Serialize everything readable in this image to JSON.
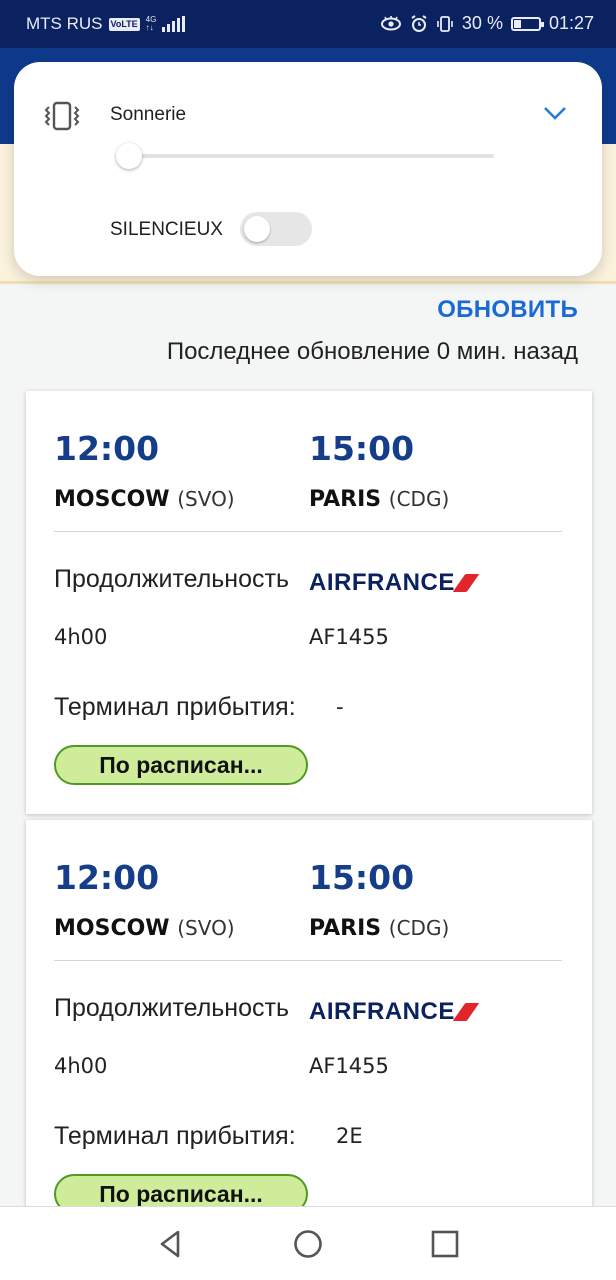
{
  "status_bar": {
    "carrier": "MTS RUS",
    "volte": "VoLTE",
    "network": "4G",
    "battery_percent_text": "30 %",
    "battery_level": 0.3,
    "time": "01:27"
  },
  "volume_popup": {
    "title": "Sonnerie",
    "slider_level": 0.0,
    "silent_label": "SILENCIEUX",
    "silent_on": false
  },
  "update": {
    "refresh_label": "ОБНОВИТЬ",
    "last_update_text": "Последнее обновление 0 мин. назад"
  },
  "flights": [
    {
      "dep_time": "12:00",
      "arr_time": "15:00",
      "dep_city": "MOSCOW",
      "dep_code": "(SVO)",
      "arr_city": "PARIS",
      "arr_code": "(CDG)",
      "duration_label": "Продолжительность",
      "duration": "4h00",
      "airline": "AIRFRANCE",
      "flight_number": "AF1455",
      "terminal_label": "Терминал прибытия:",
      "terminal": "-",
      "status": "По расписан..."
    },
    {
      "dep_time": "12:00",
      "arr_time": "15:00",
      "dep_city": "MOSCOW",
      "dep_code": "(SVO)",
      "arr_city": "PARIS",
      "arr_code": "(CDG)",
      "duration_label": "Продолжительность",
      "duration": "4h00",
      "airline": "AIRFRANCE",
      "flight_number": "AF1455",
      "terminal_label": "Терминал прибытия:",
      "terminal": "2E",
      "status": "По расписан..."
    }
  ],
  "colors": {
    "status_bar": "#0b2260",
    "accent": "#1a6ad6",
    "time_text": "#153d8a",
    "status_ok_bg": "#cfec9a",
    "status_ok_border": "#4e9a24",
    "airline_red": "#e0262b"
  },
  "icons": {
    "vibrate": "vibrate-icon",
    "expand": "chevron-down-icon",
    "nav_back": "back-triangle-icon",
    "nav_home": "home-circle-icon",
    "nav_recents": "recents-square-icon"
  }
}
